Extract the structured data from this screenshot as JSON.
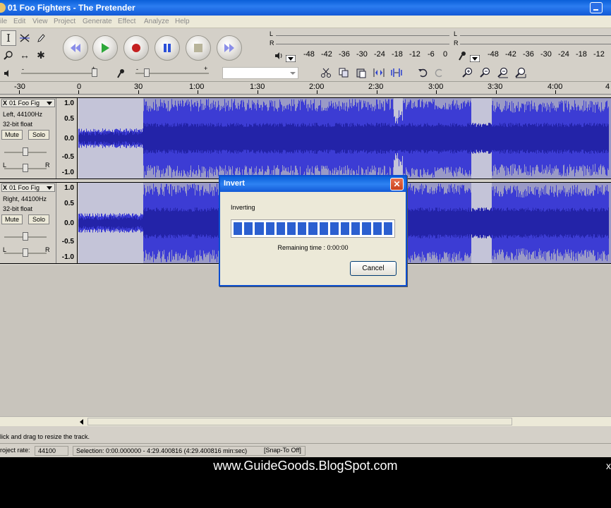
{
  "window": {
    "title": "01 Foo Fighters - The Pretender"
  },
  "menu": [
    "File",
    "Edit",
    "View",
    "Project",
    "Generate",
    "Effect",
    "Analyze",
    "Help"
  ],
  "menu_visible": [
    "ile",
    "Edit",
    "View",
    "Project",
    "Generate",
    "Effect",
    "Analyze",
    "Help"
  ],
  "tools": {
    "select_icon": "I",
    "envelope_icon": "envelope",
    "draw_icon": "pencil",
    "zoom_icon": "magnifier",
    "timeshift_icon": "↔",
    "multi_icon": "✱"
  },
  "transport": {
    "skip_start": "skip-to-start",
    "play": "play",
    "record": "record",
    "pause": "pause",
    "stop": "stop",
    "skip_end": "skip-to-end"
  },
  "meters": {
    "playback": {
      "L": "L",
      "R": "R",
      "ticks": [
        "-48",
        "-42",
        "-36",
        "-30",
        "-24",
        "-18",
        "-12",
        "-6",
        "0"
      ]
    },
    "record": {
      "L": "L",
      "R": "R",
      "ticks": [
        "-48",
        "-42",
        "-36",
        "-30",
        "-24",
        "-18",
        "-12"
      ]
    }
  },
  "mixer": {
    "plus": "+",
    "minus": "-"
  },
  "ruler": {
    "ticks": [
      "-30",
      "0",
      "30",
      "1:00",
      "1:30",
      "2:00",
      "2:30",
      "3:00",
      "3:30",
      "4:00",
      "4"
    ]
  },
  "tracks": [
    {
      "name": "01 Foo Fig",
      "close": "X",
      "channel": "Left, 44100Hz",
      "format": "32-bit float",
      "mute": "Mute",
      "solo": "Solo",
      "pan_l": "L",
      "pan_r": "R",
      "scale": [
        "1.0",
        "0.5",
        "0.0",
        "-0.5",
        "-1.0"
      ]
    },
    {
      "name": "01 Foo Fig",
      "close": "X",
      "channel": "Right, 44100Hz",
      "format": "32-bit float",
      "mute": "Mute",
      "solo": "Solo",
      "pan_l": "L",
      "pan_r": "R",
      "scale": [
        "1.0",
        "0.5",
        "0.0",
        "-0.5",
        "-1.0"
      ]
    }
  ],
  "dialog": {
    "title": "Invert",
    "message": "Inverting",
    "progress_fraction": 1.0,
    "remaining": "Remaining time : 0:00:00",
    "cancel": "Cancel"
  },
  "status": {
    "hint": "Click and drag to resize the track.",
    "hint_visible": "lick and drag to resize the track.",
    "project_rate_label": "roject rate:",
    "project_rate": "44100",
    "selection": "Selection: 0:00.000000 - 4:29.400816 (4:29.400816 min:sec)",
    "snap": "[Snap-To Off]"
  },
  "caption": "www.GuideGoods.BlogSpot.com",
  "caption_right": "x",
  "colors": {
    "wave": "#3c3cd4",
    "wave_dark": "#2323a8",
    "wave_bg": "#c4c4d8",
    "selection_bg": "#9a9ac6",
    "title_blue": "#0a5fd8"
  }
}
